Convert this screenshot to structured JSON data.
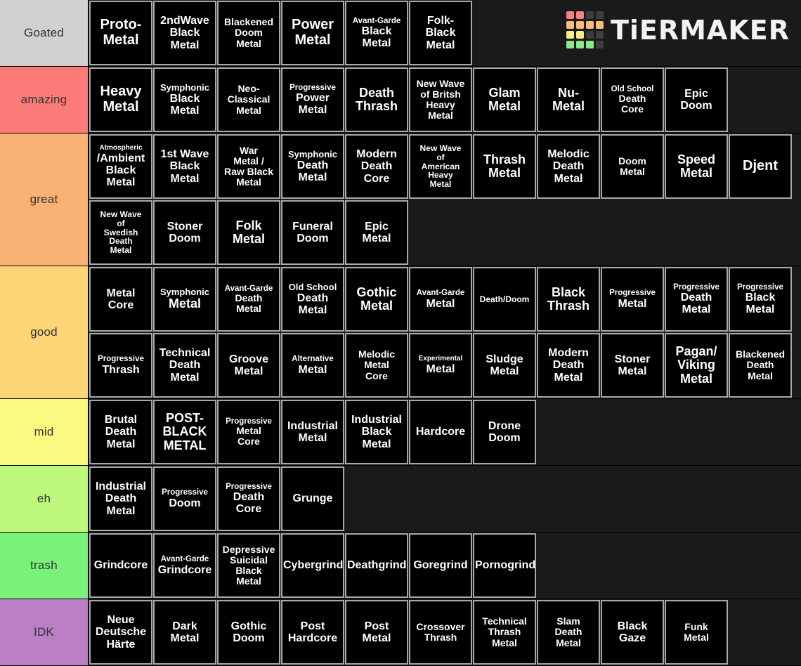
{
  "app": {
    "brand_name": "TiERMAKER",
    "logo_colors": [
      "#f98080",
      "#f98080",
      "#3d3d3d",
      "#3d3d3d",
      "#f8bb7c",
      "#f8bb7c",
      "#f8bb7c",
      "#f8bb7c",
      "#f7f08a",
      "#f7f08a",
      "#3d3d3d",
      "#3d3d3d",
      "#8ce98c",
      "#8ce98c",
      "#8ce98c",
      "#3d3d3d"
    ],
    "background_color": "#1a1a1a",
    "tile_background": "#000000",
    "tile_border": "#a8a8a8"
  },
  "tiers": [
    {
      "label": "Goated",
      "color": "#d0d0d0",
      "lines": [
        [
          {
            "lines": [
              "Proto-",
              "Metal"
            ],
            "size": "s-xl"
          },
          {
            "lines": [
              "2ndWave",
              "Black",
              "Metal"
            ],
            "size": "s-m"
          },
          {
            "lines": [
              "Blackened",
              "Doom",
              "Metal"
            ],
            "size": "s-s"
          },
          {
            "lines": [
              "Power",
              "Metal"
            ],
            "size": "s-xl"
          },
          {
            "lines": [
              "Avant-Garde",
              "Black",
              "Metal"
            ],
            "size": "s-m m-first-xs"
          },
          {
            "lines": [
              "Folk-",
              "Black",
              "Metal"
            ],
            "size": "s-m"
          }
        ]
      ]
    },
    {
      "label": "amazing",
      "color": "#fb7b78",
      "lines": [
        [
          {
            "lines": [
              "Heavy",
              "Metal"
            ],
            "size": "s-xl"
          },
          {
            "lines": [
              "Symphonic",
              "Black",
              "Metal"
            ],
            "size": "s-m m-first-s"
          },
          {
            "lines": [
              "Neo-",
              "Classical",
              "Metal"
            ],
            "size": "s-s"
          },
          {
            "lines": [
              "Progressive",
              "Power",
              "Metal"
            ],
            "size": "s-m m-first-xs"
          },
          {
            "lines": [
              "Death",
              "Thrash"
            ],
            "size": "s-l"
          },
          {
            "lines": [
              "New Wave",
              "of Britsh",
              "Heavy",
              "Metal"
            ],
            "size": "s-s"
          },
          {
            "lines": [
              "Glam",
              "Metal"
            ],
            "size": "s-l"
          },
          {
            "lines": [
              "Nu-",
              "Metal"
            ],
            "size": "s-l"
          },
          {
            "lines": [
              "Old School",
              "Death",
              "Core"
            ],
            "size": "s-s m-first-xs"
          },
          {
            "lines": [
              "Epic",
              "Doom"
            ],
            "size": "s-m"
          }
        ]
      ]
    },
    {
      "label": "great",
      "color": "#f9b273",
      "lines": [
        [
          {
            "lines": [
              "Atmospheric",
              "/Ambient",
              "Black",
              "Metal"
            ],
            "size": "s-m m-first-xxs"
          },
          {
            "lines": [
              "1st Wave",
              "Black",
              "Metal"
            ],
            "size": "s-m"
          },
          {
            "lines": [
              "War",
              "Metal /",
              "Raw Black",
              "Metal"
            ],
            "size": "s-s"
          },
          {
            "lines": [
              "Symphonic",
              "Death",
              "Metal"
            ],
            "size": "s-m m-first-s"
          },
          {
            "lines": [
              "Modern",
              "Death",
              "Core"
            ],
            "size": "s-m"
          },
          {
            "lines": [
              "New Wave",
              "of",
              "American",
              "Heavy",
              "Metal"
            ],
            "size": "s-xs"
          },
          {
            "lines": [
              "Thrash",
              "Metal"
            ],
            "size": "s-l"
          },
          {
            "lines": [
              "Melodic",
              "Death",
              "Metal"
            ],
            "size": "s-m"
          },
          {
            "lines": [
              "Doom",
              "Metal"
            ],
            "size": "s-s"
          },
          {
            "lines": [
              "Speed",
              "Metal"
            ],
            "size": "s-l"
          },
          {
            "lines": [
              "Djent"
            ],
            "size": "s-xl"
          }
        ],
        [
          {
            "lines": [
              "New Wave",
              "of",
              "Swedish",
              "Death",
              "Metal"
            ],
            "size": "s-xs"
          },
          {
            "lines": [
              "Stoner",
              "Doom"
            ],
            "size": "s-m"
          },
          {
            "lines": [
              "Folk",
              "Metal"
            ],
            "size": "s-l"
          },
          {
            "lines": [
              "Funeral",
              "Doom"
            ],
            "size": "s-m"
          },
          {
            "lines": [
              "Epic",
              "Metal"
            ],
            "size": "s-m"
          }
        ]
      ]
    },
    {
      "label": "good",
      "color": "#fcd577",
      "lines": [
        [
          {
            "lines": [
              "Metal",
              "Core"
            ],
            "size": "s-m"
          },
          {
            "lines": [
              "Symphonic",
              "Metal"
            ],
            "size": "s-l m-first-s"
          },
          {
            "lines": [
              "Avant-Garde",
              "Death",
              "Metal"
            ],
            "size": "s-s m-first-xs"
          },
          {
            "lines": [
              "Old School",
              "Death",
              "Metal"
            ],
            "size": "s-m m-first-s"
          },
          {
            "lines": [
              "Gothic",
              "Metal"
            ],
            "size": "s-l"
          },
          {
            "lines": [
              "Avant-Garde",
              "Metal"
            ],
            "size": "s-m m-first-xs"
          },
          {
            "lines": [
              "Death/Doom"
            ],
            "size": "s-xs"
          },
          {
            "lines": [
              "Black",
              "Thrash"
            ],
            "size": "s-l"
          },
          {
            "lines": [
              "Progressive",
              "Metal"
            ],
            "size": "s-m m-first-xs"
          },
          {
            "lines": [
              "Progressive",
              "Death",
              "Metal"
            ],
            "size": "s-m m-first-xs"
          },
          {
            "lines": [
              "Progressive",
              "Black",
              "Metal"
            ],
            "size": "s-m m-first-xs"
          }
        ],
        [
          {
            "lines": [
              "Progressive",
              "Thrash"
            ],
            "size": "s-m m-first-xs"
          },
          {
            "lines": [
              "Technical",
              "Death",
              "Metal"
            ],
            "size": "s-m"
          },
          {
            "lines": [
              "Groove",
              "Metal"
            ],
            "size": "s-m"
          },
          {
            "lines": [
              "Alternative",
              "Metal"
            ],
            "size": "s-m m-first-xs"
          },
          {
            "lines": [
              "Melodic",
              "Metal",
              "Core"
            ],
            "size": "s-s"
          },
          {
            "lines": [
              "Experimental",
              "Metal"
            ],
            "size": "s-m m-first-xxs"
          },
          {
            "lines": [
              "Sludge",
              "Metal"
            ],
            "size": "s-m"
          },
          {
            "lines": [
              "Modern",
              "Death",
              "Metal"
            ],
            "size": "s-m"
          },
          {
            "lines": [
              "Stoner",
              "Metal"
            ],
            "size": "s-m"
          },
          {
            "lines": [
              "Pagan/",
              "Viking",
              "Metal"
            ],
            "size": "s-l"
          },
          {
            "lines": [
              "Blackened",
              "Death",
              "Metal"
            ],
            "size": "s-s"
          }
        ]
      ]
    },
    {
      "label": "mid",
      "color": "#fafa80",
      "lines": [
        [
          {
            "lines": [
              "Brutal",
              "Death",
              "Metal"
            ],
            "size": "s-m"
          },
          {
            "lines": [
              "POST-",
              "BLACK",
              "METAL"
            ],
            "size": "s-l"
          },
          {
            "lines": [
              "Progressive",
              "Metal",
              "Core"
            ],
            "size": "s-s m-first-xs"
          },
          {
            "lines": [
              "Industrial",
              "Metal"
            ],
            "size": "s-m"
          },
          {
            "lines": [
              "Industrial",
              "Black",
              "Metal"
            ],
            "size": "s-m"
          },
          {
            "lines": [
              "Hardcore"
            ],
            "size": "s-m"
          },
          {
            "lines": [
              "Drone",
              "Doom"
            ],
            "size": "s-m"
          }
        ]
      ]
    },
    {
      "label": "eh",
      "color": "#bdf87c",
      "lines": [
        [
          {
            "lines": [
              "Industrial",
              "Death",
              "Metal"
            ],
            "size": "s-m"
          },
          {
            "lines": [
              "Progressive",
              "Doom"
            ],
            "size": "s-m m-first-xs"
          },
          {
            "lines": [
              "Progressive",
              "Death",
              "Core"
            ],
            "size": "s-m m-first-xs"
          },
          {
            "lines": [
              "Grunge"
            ],
            "size": "s-m"
          }
        ]
      ]
    },
    {
      "label": "trash",
      "color": "#79f279",
      "lines": [
        [
          {
            "lines": [
              "Grindcore"
            ],
            "size": "s-m"
          },
          {
            "lines": [
              "Avant-Garde",
              "Grindcore"
            ],
            "size": "s-m m-first-xs"
          },
          {
            "lines": [
              "Depressive",
              "Suicidal",
              "Black",
              "Metal"
            ],
            "size": "s-s"
          },
          {
            "lines": [
              "Cybergrind"
            ],
            "size": "s-m"
          },
          {
            "lines": [
              "Deathgrind"
            ],
            "size": "s-m"
          },
          {
            "lines": [
              "Goregrind"
            ],
            "size": "s-m"
          },
          {
            "lines": [
              "Pornogrind"
            ],
            "size": "s-m"
          }
        ]
      ]
    },
    {
      "label": "IDK",
      "color": "#bb7fc5",
      "lines": [
        [
          {
            "lines": [
              "Neue",
              "Deutsche",
              "Härte"
            ],
            "size": "s-m"
          },
          {
            "lines": [
              "Dark",
              "Metal"
            ],
            "size": "s-m"
          },
          {
            "lines": [
              "Gothic",
              "Doom"
            ],
            "size": "s-m"
          },
          {
            "lines": [
              "Post",
              "Hardcore"
            ],
            "size": "s-m"
          },
          {
            "lines": [
              "Post",
              "Metal"
            ],
            "size": "s-m"
          },
          {
            "lines": [
              "Crossover",
              "Thrash"
            ],
            "size": "s-s"
          },
          {
            "lines": [
              "Technical",
              "Thrash",
              "Metal"
            ],
            "size": "s-s"
          },
          {
            "lines": [
              "Slam",
              "Death",
              "Metal"
            ],
            "size": "s-s"
          },
          {
            "lines": [
              "Black",
              "Gaze"
            ],
            "size": "s-m"
          },
          {
            "lines": [
              "Funk",
              "Metal"
            ],
            "size": "s-s"
          }
        ]
      ]
    }
  ]
}
